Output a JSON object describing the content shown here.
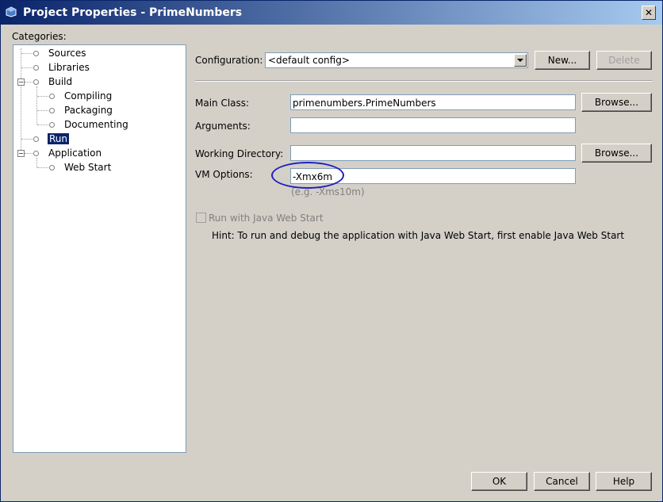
{
  "window": {
    "title": "Project Properties - PrimeNumbers",
    "close_glyph": "✕"
  },
  "categories": {
    "label": "Categories:",
    "items": [
      {
        "label": "Sources"
      },
      {
        "label": "Libraries"
      },
      {
        "label": "Build"
      },
      {
        "label": "Compiling"
      },
      {
        "label": "Packaging"
      },
      {
        "label": "Documenting"
      },
      {
        "label": "Run"
      },
      {
        "label": "Application"
      },
      {
        "label": "Web Start"
      }
    ],
    "selected": "Run"
  },
  "configuration": {
    "label": "Configuration:",
    "value": "<default config>",
    "new_button": "New...",
    "delete_button": "Delete"
  },
  "form": {
    "main_class": {
      "label": "Main Class:",
      "value": "primenumbers.PrimeNumbers",
      "browse": "Browse..."
    },
    "arguments": {
      "label": "Arguments:",
      "value": ""
    },
    "working_directory": {
      "label": "Working Directory:",
      "value": "",
      "browse": "Browse..."
    },
    "vm_options": {
      "label": "VM Options:",
      "value": "-Xmx6m",
      "hint": "(e.g. -Xms10m)"
    },
    "web_start_checkbox": {
      "label": "Run with Java Web Start",
      "checked": false,
      "enabled": false
    },
    "hint": "Hint: To run and debug the application with Java Web Start, first enable Java Web Start"
  },
  "footer": {
    "ok": "OK",
    "cancel": "Cancel",
    "help": "Help"
  },
  "colors": {
    "titlebar_start": "#0a246a",
    "titlebar_end": "#a6caf0",
    "annotation_ellipse": "#2020c0",
    "selection": "#0a246a"
  }
}
